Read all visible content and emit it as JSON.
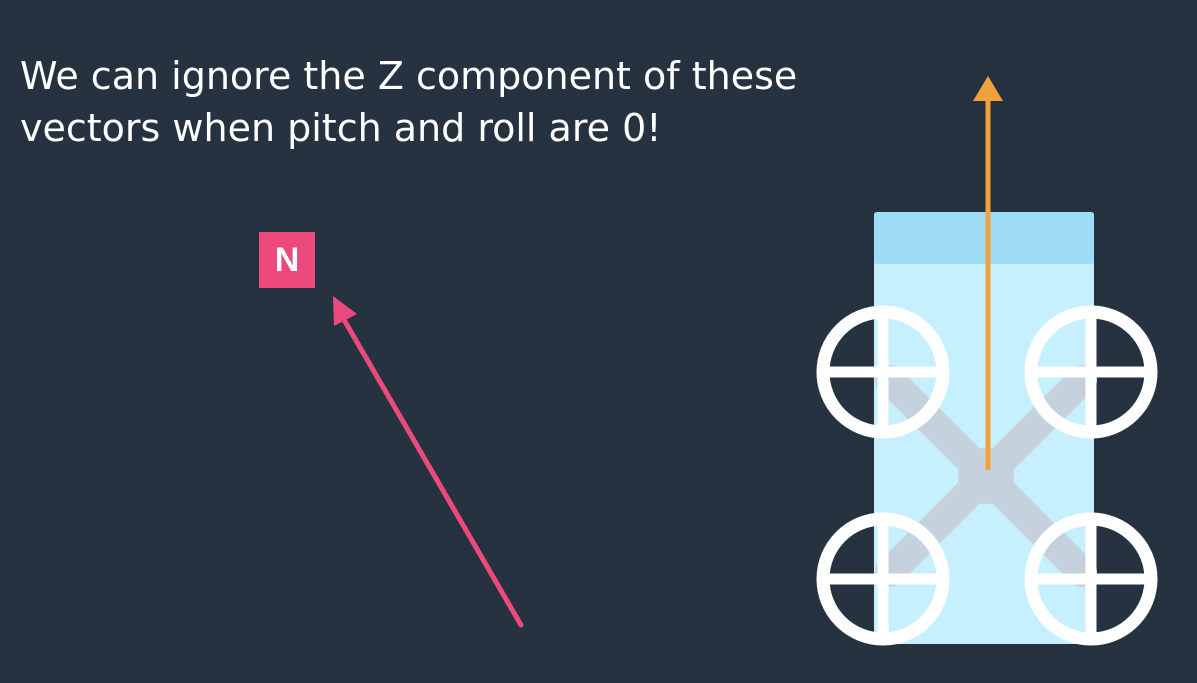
{
  "caption": {
    "line1": "We can ignore the Z component of these",
    "line2": "vectors when pitch and roll are 0!"
  },
  "north_label": "N",
  "colors": {
    "background": "#263240",
    "north_vector": "#ec4a7c",
    "heading_vector": "#f2a23c",
    "drone_body_top": "#9fdcf6",
    "drone_body": "#c6f0fd",
    "drone_frame": "#c5d1dc",
    "rotor": "#ffffff"
  }
}
